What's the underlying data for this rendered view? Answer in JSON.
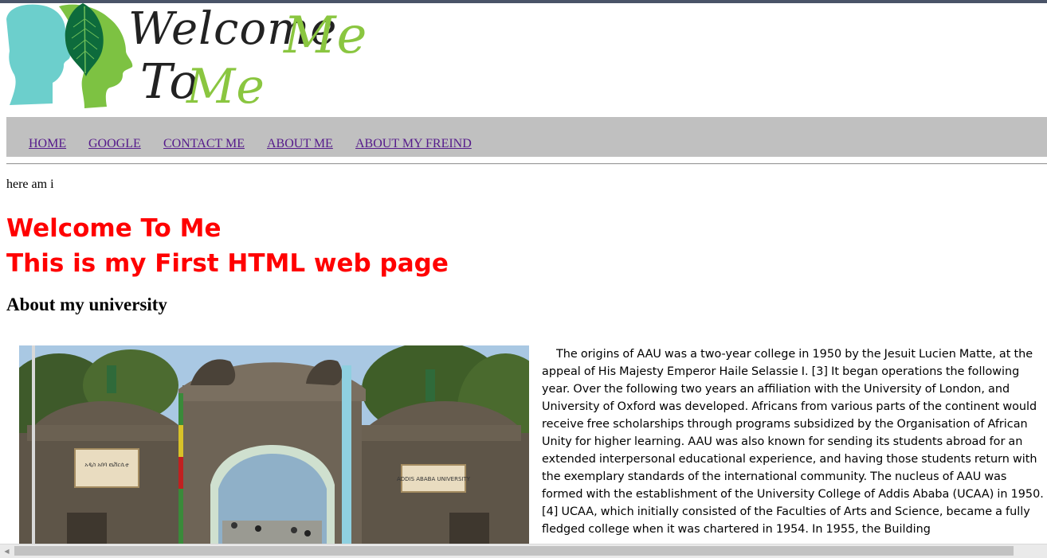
{
  "logo": {
    "line1_a": "Welcome",
    "line1_b": "Me",
    "line2_a": "To",
    "line2_b": "Me",
    "colors": {
      "teal": "#6ccfcc",
      "green": "#7dc242",
      "dark_leaf": "#0d6b3c",
      "ink": "#222222"
    }
  },
  "nav": {
    "items": [
      {
        "label": "HOME"
      },
      {
        "label": "GOOGLE"
      },
      {
        "label": "CONTACT ME"
      },
      {
        "label": "ABOUT ME"
      },
      {
        "label": "ABOUT MY FREIND"
      }
    ],
    "link_color": "#551a8b",
    "bar_color": "#c0c0c0"
  },
  "intro_text": "here am i",
  "heading": {
    "line1": "Welcome To Me",
    "line2": "This is my First HTML web page",
    "color": "#ff0000"
  },
  "about_heading": "About my university",
  "article": {
    "text": "The origins of AAU was a two-year college in 1950 by the Jesuit Lucien Matte, at the appeal of His Majesty Emperor Haile Selassie I. [3] It began operations the following year. Over the following two years an affiliation with the University of London, and University of Oxford was developed. Africans from various parts of the continent would receive free scholarships through programs subsidized by the Organisation of African Unity for higher learning. AAU was also known for sending its students abroad for an extended interpersonal educational experience, and having those students return with the exemplary standards of the international community. The nucleus of AAU was formed with the establishment of the University College of Addis Ababa (UCAA) in 1950. [4] UCAA, which initially consisted of the Faculties of Arts and Science, became a fully fledged college when it was chartered in 1954. In 1955, the Building"
  },
  "photo": {
    "plaque_left": "አዲስ አበባ ዩኒቨርሲቲ",
    "plaque_right": "ADDIS ABABA UNIVERSITY"
  },
  "scrollbar": {
    "left_arrow": "◀"
  }
}
